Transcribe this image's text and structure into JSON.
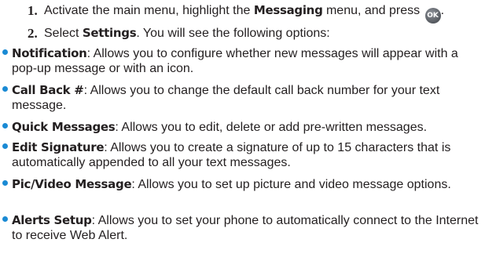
{
  "steps": [
    {
      "number": "1.",
      "pre": "Activate the main menu, highlight the ",
      "bold": "Messaging",
      "post": " menu, and press ",
      "icon": "ok-key-icon",
      "icon_label": "OK",
      "end": "."
    },
    {
      "number": "2.",
      "pre": "Select ",
      "bold": "Settings",
      "post": ". You will see the following options:"
    }
  ],
  "options": [
    {
      "term": "Notification",
      "desc": ": Allows you to configure whether new messages will appear with a pop-up message or with an icon."
    },
    {
      "term": "Call Back #",
      "desc": ": Allows you to change the default call back number for your text message."
    },
    {
      "term": "Quick Messages",
      "desc": ": Allows you to edit, delete or add pre-written messages."
    },
    {
      "term": "Edit Signature",
      "desc": ": Allows you to create a signature of up to 15 characters that is automatically appended to all your text messages."
    },
    {
      "term": "Pic/Video Message",
      "desc": ": Allows you to set up picture and video message options."
    },
    {
      "term": "Alerts Setup",
      "desc": ": Allows you to set your phone to automatically connect to the Internet to receive Web Alert."
    }
  ],
  "colors": {
    "bullet": "#1a8ad4",
    "text": "#231f20"
  }
}
